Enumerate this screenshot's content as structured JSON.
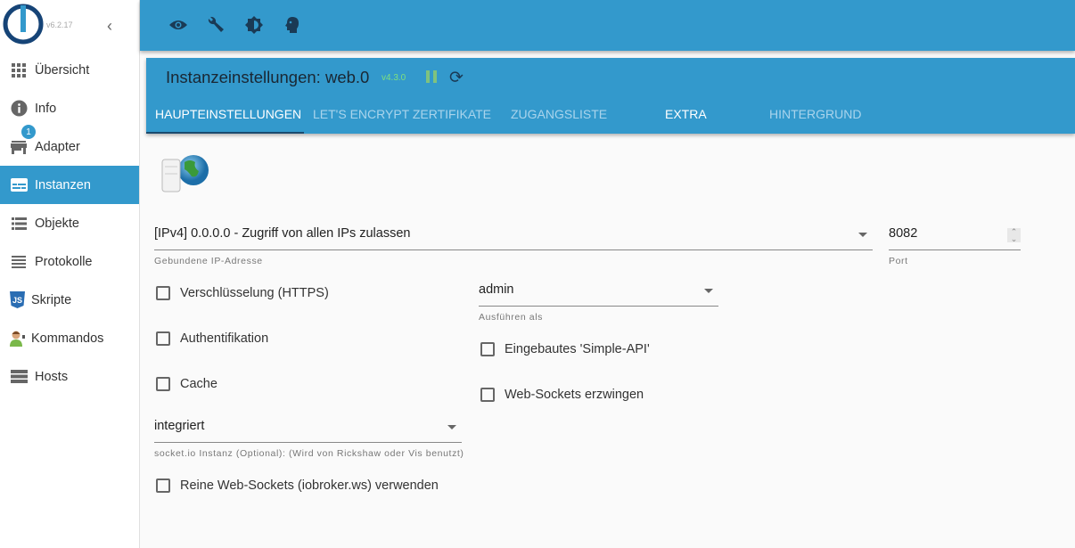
{
  "app": {
    "version": "v6.2.17"
  },
  "sidebar": {
    "items": [
      {
        "label": "Übersicht",
        "icon": "apps-grid-icon"
      },
      {
        "label": "Info",
        "icon": "info-icon"
      },
      {
        "label": "Adapter",
        "icon": "store-icon",
        "badge": "1"
      },
      {
        "label": "Instanzen",
        "icon": "instances-icon",
        "active": true
      },
      {
        "label": "Objekte",
        "icon": "list-icon"
      },
      {
        "label": "Protokolle",
        "icon": "logs-icon"
      },
      {
        "label": "Skripte",
        "icon": "javascript-icon"
      },
      {
        "label": "Kommandos",
        "icon": "user-command-icon"
      },
      {
        "label": "Hosts",
        "icon": "server-icon"
      }
    ]
  },
  "topbar": {
    "icons": [
      "eye-icon",
      "wrench-icon",
      "brightness-icon",
      "expert-mode-icon"
    ]
  },
  "panel": {
    "title": "Instanzeinstellungen: web.0",
    "version": "v4.3.0",
    "tabs": [
      "HAUPTEINSTELLUNGEN",
      "LET'S ENCRYPT ZERTIFIKATE",
      "ZUGANGSLISTE",
      "EXTRA",
      "HINTERGRUND"
    ],
    "active_tab": 0
  },
  "form": {
    "bind_ip": {
      "value": "[IPv4] 0.0.0.0 - Zugriff von allen IPs zulassen",
      "help": "Gebundene IP-Adresse"
    },
    "port": {
      "value": "8082",
      "help": "Port"
    },
    "run_as": {
      "value": "admin",
      "help": "Ausführen als"
    },
    "socketio": {
      "value": "integriert",
      "help": "socket.io Instanz (Optional): (Wird von Rickshaw oder Vis benutzt)"
    },
    "checkboxes": {
      "https": {
        "label": "Verschlüsselung (HTTPS)",
        "checked": false
      },
      "auth": {
        "label": "Authentifikation",
        "checked": false
      },
      "cache": {
        "label": "Cache",
        "checked": false
      },
      "simple_api": {
        "label": "Eingebautes 'Simple-API'",
        "checked": false
      },
      "force_ws": {
        "label": "Web-Sockets erzwingen",
        "checked": false
      },
      "pure_ws": {
        "label": "Reine Web-Sockets (iobroker.ws) verwenden",
        "checked": false
      }
    }
  }
}
